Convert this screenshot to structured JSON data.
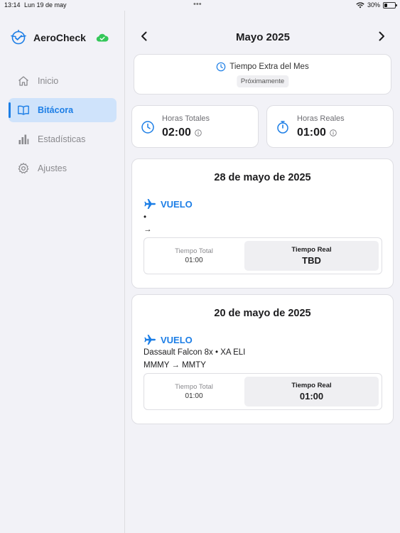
{
  "status_bar": {
    "time": "13:14",
    "date": "Lun 19 de may",
    "dots": "•••",
    "battery": "30%",
    "battery_level": 0.3
  },
  "sidebar": {
    "app_name": "AeroCheck",
    "items": [
      {
        "label": "Inicio",
        "icon": "house-icon",
        "active": false
      },
      {
        "label": "Bitácora",
        "icon": "book-icon",
        "active": true
      },
      {
        "label": "Estadísticas",
        "icon": "chart-bars-icon",
        "active": false
      },
      {
        "label": "Ajustes",
        "icon": "gear-icon",
        "active": false
      }
    ]
  },
  "header": {
    "month": "Mayo 2025",
    "prev_icon": "chevron-left-icon",
    "next_icon": "chevron-right-icon"
  },
  "extra": {
    "title": "Tiempo Extra del Mes",
    "badge": "Próximamente"
  },
  "stats": {
    "total_label": "Horas Totales",
    "total_value": "02:00",
    "real_label": "Horas Reales",
    "real_value": "01:00"
  },
  "entries": [
    {
      "date": "28 de mayo de 2025",
      "type": "VUELO",
      "aircraft": "•",
      "route": "→",
      "total_label": "Tiempo Total",
      "total_value": "01:00",
      "real_label": "Tiempo Real",
      "real_value": "TBD"
    },
    {
      "date": "20 de mayo de 2025",
      "type": "VUELO",
      "aircraft": "Dassault Falcon 8x • XA ELI",
      "route": "MMMY → MMTY",
      "total_label": "Tiempo Total",
      "total_value": "01:00",
      "real_label": "Tiempo Real",
      "real_value": "01:00"
    }
  ],
  "colors": {
    "accent": "#1c7ee6",
    "active_bg": "#cfe3fb",
    "cloud": "#34c759",
    "background": "#f2f2f7"
  }
}
